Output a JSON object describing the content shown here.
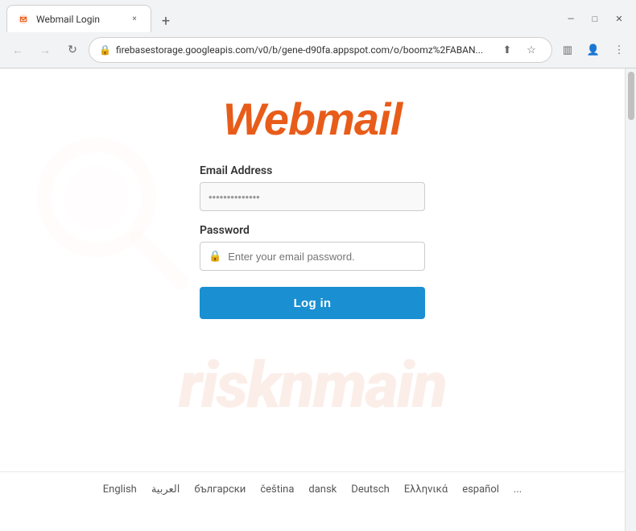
{
  "browser": {
    "tab": {
      "favicon": "webmail-icon",
      "title": "Webmail Login",
      "close_label": "×"
    },
    "new_tab_label": "+",
    "window_controls": {
      "minimize": "—",
      "maximize": "□",
      "close": "✕"
    },
    "nav": {
      "back": "←",
      "forward": "→",
      "reload": "↻"
    },
    "address": {
      "url": "firebasestorage.googleapis.com/v0/b/gene-d90fa.appspot.com/o/boomz%2FABAN...",
      "lock": "🔒"
    },
    "addr_actions": {
      "share": "⬆",
      "star": "☆",
      "browser_menu": "⋮",
      "sidebar": "▥",
      "profile": "👤"
    }
  },
  "page": {
    "logo_text": "Webmail",
    "email_label": "Email Address",
    "email_placeholder": "••••••••••••••",
    "password_label": "Password",
    "password_placeholder": "Enter your email password.",
    "login_button": "Log in"
  },
  "languages": {
    "items": [
      "English",
      "العربية",
      "български",
      "čeština",
      "dansk",
      "Deutsch",
      "Ελληνικά",
      "español",
      "..."
    ]
  }
}
